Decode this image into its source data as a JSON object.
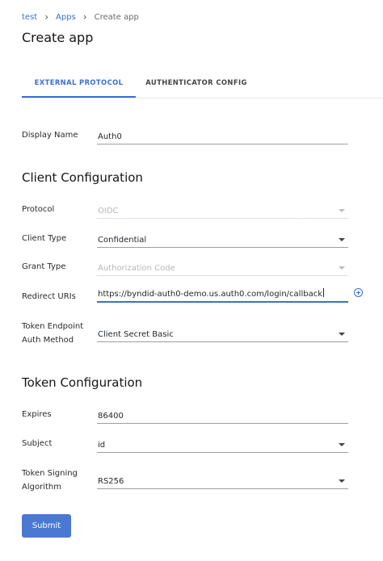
{
  "breadcrumb": {
    "items": [
      "test",
      "Apps"
    ],
    "current": "Create app"
  },
  "page": {
    "title": "Create app"
  },
  "tabs": [
    {
      "label": "EXTERNAL PROTOCOL",
      "active": true
    },
    {
      "label": "AUTHENTICATOR CONFIG",
      "active": false
    }
  ],
  "display_name": {
    "label": "Display Name",
    "value": "Auth0"
  },
  "client_config": {
    "title": "Client Configuration",
    "protocol": {
      "label": "Protocol",
      "value": "OIDC"
    },
    "client_type": {
      "label": "Client Type",
      "value": "Confidential"
    },
    "grant_type": {
      "label": "Grant Type",
      "value": "Authorization Code"
    },
    "redirect_uris": {
      "label": "Redirect URIs",
      "value": "https://byndid-auth0-demo.us.auth0.com/login/callback"
    },
    "token_endpoint": {
      "label_line1": "Token Endpoint",
      "label_line2": "Auth Method",
      "value": "Client Secret Basic"
    }
  },
  "token_config": {
    "title": "Token Configuration",
    "expires": {
      "label": "Expires",
      "value": "86400"
    },
    "subject": {
      "label": "Subject",
      "value": "id"
    },
    "signing": {
      "label_line1": "Token Signing",
      "label_line2": "Algorithm",
      "value": "RS256"
    }
  },
  "submit_label": "Submit",
  "colors": {
    "accent": "#3b6fd1",
    "button": "#4a78d3"
  }
}
